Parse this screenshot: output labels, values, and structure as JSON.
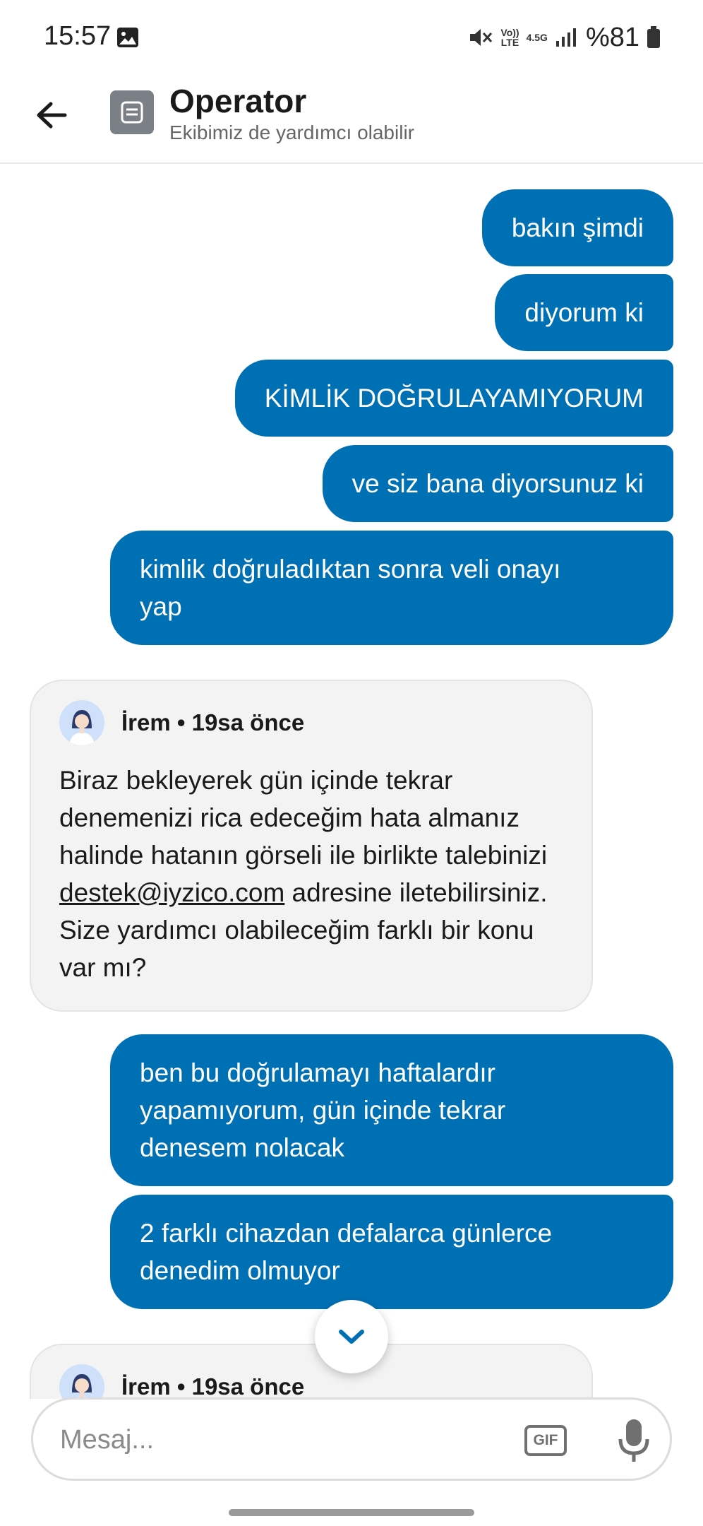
{
  "status_bar": {
    "time": "15:57",
    "volte": "Vo))\nLTE",
    "network": "4.5G",
    "battery": "%81",
    "icons": [
      "image-icon",
      "mute-icon",
      "volte-icon",
      "network-icon",
      "signal-icon",
      "battery-icon"
    ]
  },
  "header": {
    "title": "Operator",
    "subtitle": "Ekibimiz de yardımcı olabilir",
    "back_icon": "arrow-left-icon",
    "avatar_icon": "operator-icon"
  },
  "messages": [
    {
      "from": "user",
      "text": "bakın şimdi"
    },
    {
      "from": "user",
      "text": "diyorum ki"
    },
    {
      "from": "user",
      "text": "KİMLİK DOĞRULAYAMIYORUM"
    },
    {
      "from": "user",
      "text": "ve siz bana diyorsunuz ki"
    },
    {
      "from": "user",
      "line1": "kimlik doğruladıktan sonra veli onayı",
      "line2": "yap"
    },
    {
      "from": "agent",
      "meta": "İrem • 19sa önce",
      "text_before": "Biraz bekleyerek gün içinde tekrar denemenizi rica edeceğim hata almanız halinde hatanın görseli ile birlikte talebinizi ",
      "link": "destek@iyzico.com",
      "text_after": " adresine iletebilirsiniz. Size yardımcı olabileceğim farklı bir konu var mı?"
    },
    {
      "from": "user",
      "line1": "ben bu doğrulamayı haftalardır",
      "line2": "yapamıyorum, gün içinde tekrar",
      "line3": "denesem nolacak"
    },
    {
      "from": "user",
      "line1": "2 farklı cihazdan defalarca günlerce",
      "line2": "denedim olmuyor"
    },
    {
      "from": "agent",
      "meta": "İrem • 19sa önce"
    }
  ],
  "scroll_down_icon": "chevron-down-icon",
  "composer": {
    "placeholder": "Mesaj...",
    "gif_label": "GIF",
    "mic_icon": "microphone-icon"
  },
  "colors": {
    "outgoing_bubble": "#0070b5",
    "incoming_bubble": "#f3f3f3"
  }
}
